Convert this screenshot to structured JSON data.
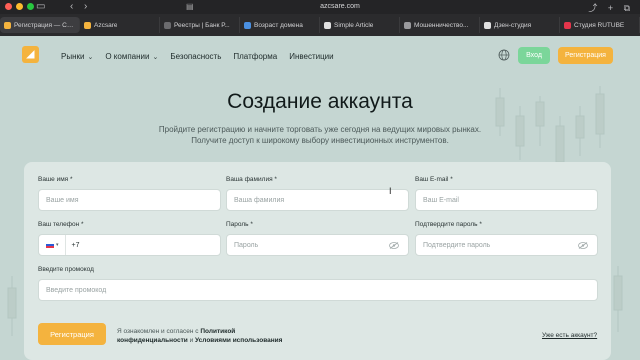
{
  "browser": {
    "address": "azcsare.com",
    "tabs": [
      {
        "title": "Регистрация — Соз...",
        "active": true,
        "favicon_color": "#f4b33e"
      },
      {
        "title": "Azcsare",
        "active": false,
        "favicon_color": "#f4b33e"
      },
      {
        "title": "Реестры | Банк Р...",
        "active": false,
        "favicon_color": "#6b6b6e"
      },
      {
        "title": "Возраст домена",
        "active": false,
        "favicon_color": "#4a90e2"
      },
      {
        "title": "Simple Article",
        "active": false,
        "favicon_color": "#e0e0e0"
      },
      {
        "title": "Мошенничество...",
        "active": false,
        "favicon_color": "#9a9a9d"
      },
      {
        "title": "Дзен-студия",
        "active": false,
        "favicon_color": "#e0e0e0"
      },
      {
        "title": "Студия RUTUBE",
        "active": false,
        "favicon_color": "#e5354b"
      }
    ]
  },
  "header": {
    "logo_glyph": "◢",
    "nav": [
      {
        "label": "Рынки",
        "has_dropdown": true
      },
      {
        "label": "О компании",
        "has_dropdown": true
      },
      {
        "label": "Безопасность",
        "has_dropdown": false
      },
      {
        "label": "Платформа",
        "has_dropdown": false
      },
      {
        "label": "Инвестиции",
        "has_dropdown": false
      }
    ],
    "login_label": "Вход",
    "register_label": "Регистрация"
  },
  "hero": {
    "title": "Создание аккаунта",
    "subtitle_line1": "Пройдите регистрацию и начните торговать уже сегодня на ведущих мировых рынках.",
    "subtitle_line2": "Получите доступ к широкому выбору инвестиционных инструментов."
  },
  "form": {
    "first_name": {
      "label": "Ваше имя *",
      "placeholder": "Ваше имя"
    },
    "last_name": {
      "label": "Ваша фамилия *",
      "placeholder": "Ваша фамилия"
    },
    "email": {
      "label": "Ваш E-mail *",
      "placeholder": "Ваш E-mail"
    },
    "phone": {
      "label": "Ваш телефон *",
      "value": "+7"
    },
    "password": {
      "label": "Пароль *",
      "placeholder": "Пароль"
    },
    "password_confirm": {
      "label": "Подтвердите пароль *",
      "placeholder": "Подтвердите пароль"
    },
    "promo": {
      "label": "Введите промокод",
      "placeholder": "Введите промокод"
    },
    "submit_label": "Регистрация",
    "consent_prefix": "Я ознакомлен и согласен с",
    "consent_privacy": "Политикой конфиденциальности",
    "consent_and": "и",
    "consent_terms": "Условиями использования",
    "have_account": "Уже есть аккаунт?"
  },
  "colors": {
    "accent": "#f4b33e",
    "login": "#7bd69a",
    "background": "#c5d6d2",
    "card": "#dde7e4"
  }
}
